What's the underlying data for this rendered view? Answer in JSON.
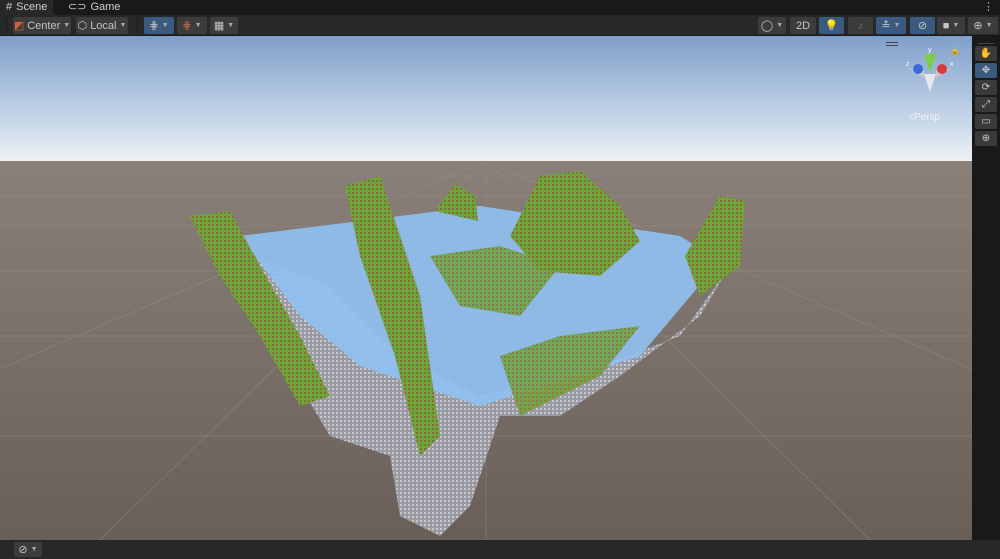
{
  "tabs": [
    {
      "label": "Scene",
      "icon": "grid-icon"
    },
    {
      "label": "Game",
      "icon": "gamepad-icon"
    }
  ],
  "toolbar": {
    "pivot": "Center",
    "space": "Local",
    "two_d": "2D"
  },
  "gizmo": {
    "x": "x",
    "y": "y",
    "z": "z",
    "projection": "Persp"
  },
  "tools": [
    {
      "name": "hand-tool",
      "glyph": "✋"
    },
    {
      "name": "move-tool",
      "glyph": "✥"
    },
    {
      "name": "rotate-tool",
      "glyph": "⟳"
    },
    {
      "name": "scale-tool",
      "glyph": "⤢"
    },
    {
      "name": "rect-tool",
      "glyph": "▭"
    },
    {
      "name": "transform-tool",
      "glyph": "⊕"
    }
  ],
  "colors": {
    "accent": "#3a5a80",
    "sky_top": "#7f9fc9",
    "ground": "#6e625c",
    "water": "#8fc0f0",
    "grass": "#6aa83a",
    "rock": "#b0b0b8"
  }
}
